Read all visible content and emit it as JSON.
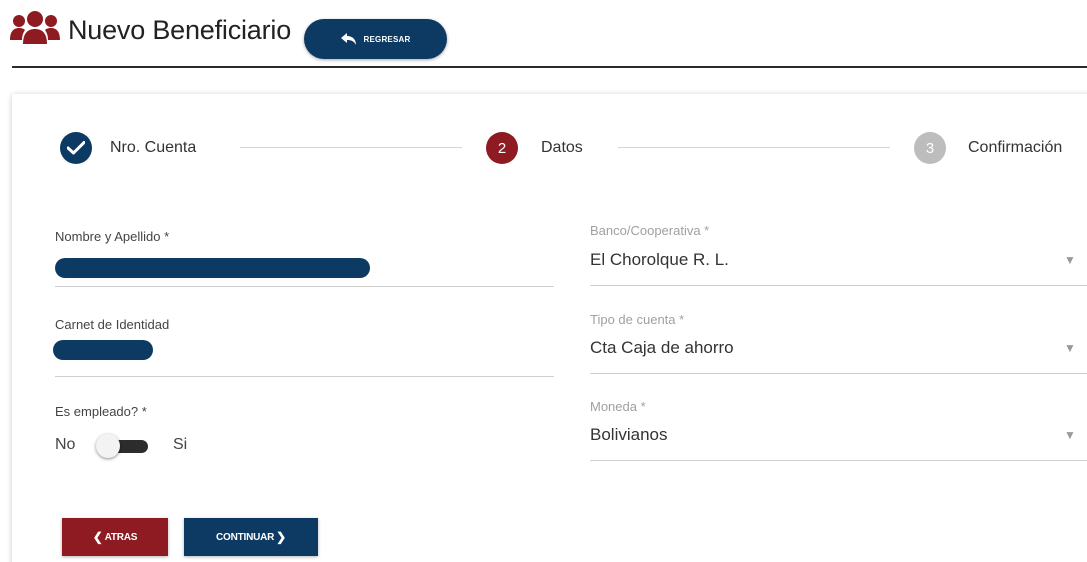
{
  "header": {
    "title": "Nuevo Beneficiario",
    "back_button": "REGRESAR",
    "icon": "users-icon"
  },
  "stepper": {
    "steps": [
      {
        "number": "1",
        "label": "Nro. Cuenta",
        "state": "completed"
      },
      {
        "number": "2",
        "label": "Datos",
        "state": "active"
      },
      {
        "number": "3",
        "label": "Confirmación",
        "state": "pending"
      }
    ]
  },
  "form": {
    "name": {
      "label": "Nombre y Apellido *",
      "value_redacted": true
    },
    "id_card": {
      "label": "Carnet de Identidad",
      "value_redacted": true
    },
    "employee": {
      "label": "Es empleado? *",
      "off_label": "No",
      "on_label": "Si",
      "checked": false
    },
    "bank": {
      "label": "Banco/Cooperativa *",
      "value": "El Chorolque R. L."
    },
    "account_type": {
      "label": "Tipo de cuenta *",
      "value": "Cta Caja de ahorro"
    },
    "currency": {
      "label": "Moneda *",
      "value": "Bolivianos"
    }
  },
  "actions": {
    "back": "ATRAS",
    "continue": "CONTINUAR"
  },
  "colors": {
    "primary": "#0d3a63",
    "accent": "#8e1a22",
    "step_pending": "#bdbdbd"
  }
}
